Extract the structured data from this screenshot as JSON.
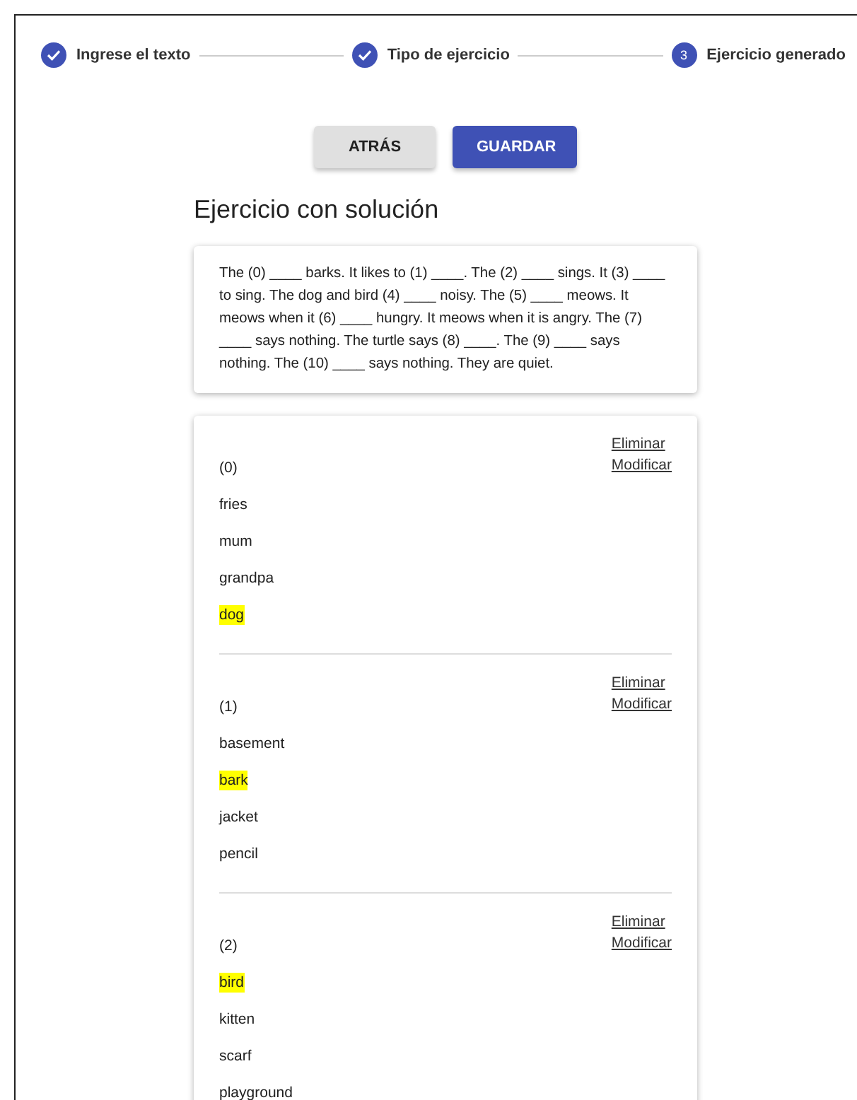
{
  "stepper": [
    {
      "label": "Ingrese el texto",
      "completed": true
    },
    {
      "label": "Tipo de ejercicio",
      "completed": true
    },
    {
      "label": "Ejercicio generado",
      "completed": false,
      "number": "3"
    }
  ],
  "buttons": [
    {
      "label": "ATRÁS",
      "kind": "secondary"
    },
    {
      "label": "GUARDAR",
      "kind": "primary"
    }
  ],
  "title": "Ejercicio con solución",
  "text": "The (0) ____ barks. It likes to (1) ____. The (2) ____ sings. It (3) ____ to sing. The dog and bird (4) ____ noisy. The (5) ____ meows. It meows when it (6) ____ hungry. It meows when it is angry. The (7) ____ says nothing. The turtle says (8) ____. The (9) ____ says nothing. The (10) ____ says nothing. They are quiet.",
  "questions": [
    {
      "number": "(0)",
      "actions": [
        "Eliminar",
        "Modificar"
      ],
      "options": [
        {
          "text": "fries",
          "selected": false
        },
        {
          "text": "mum",
          "selected": false
        },
        {
          "text": "grandpa",
          "selected": false
        },
        {
          "text": "dog",
          "selected": true
        }
      ]
    },
    {
      "number": "(1)",
      "actions": [
        "Eliminar",
        "Modificar"
      ],
      "options": [
        {
          "text": "basement",
          "selected": false
        },
        {
          "text": "bark",
          "selected": true
        },
        {
          "text": "jacket",
          "selected": false
        },
        {
          "text": "pencil",
          "selected": false
        }
      ]
    },
    {
      "number": "(2)",
      "actions": [
        "Eliminar",
        "Modificar"
      ],
      "options": [
        {
          "text": "bird",
          "selected": true
        },
        {
          "text": "kitten",
          "selected": false
        },
        {
          "text": "scarf",
          "selected": false
        },
        {
          "text": "playground",
          "selected": false
        }
      ]
    }
  ]
}
